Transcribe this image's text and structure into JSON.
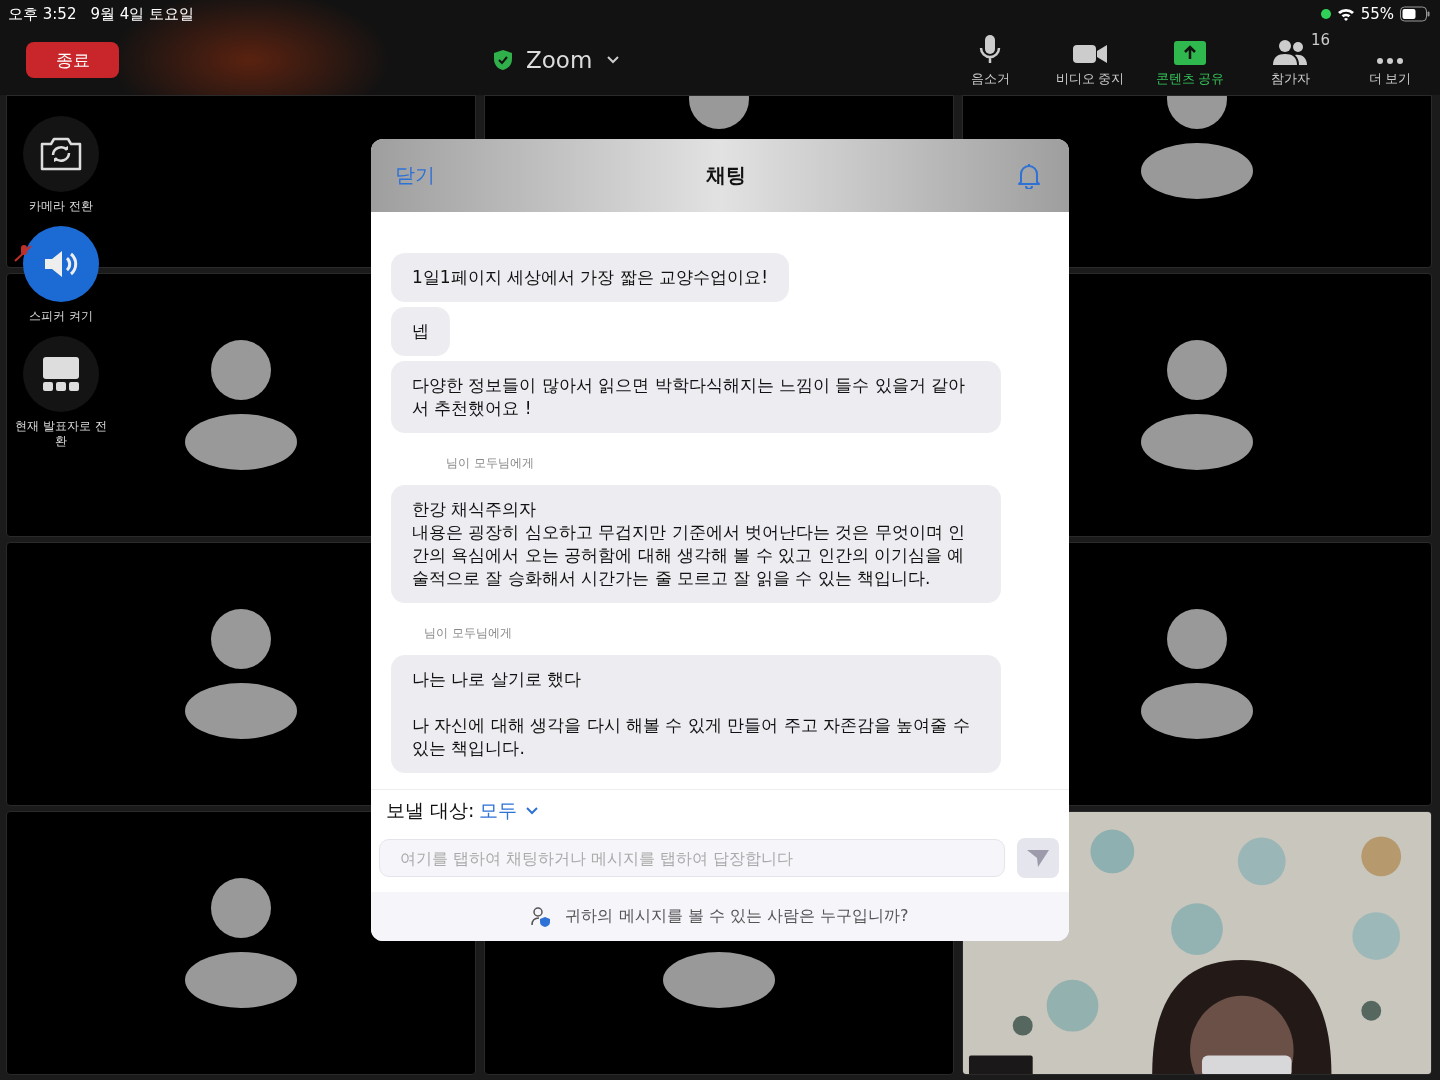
{
  "status_bar": {
    "time": "오후 3:52",
    "date": "9월 4일 토요일",
    "battery": "55%"
  },
  "toolbar": {
    "end_button": "종료",
    "title": "Zoom",
    "actions": [
      {
        "kind": "mic",
        "label": "음소거"
      },
      {
        "kind": "video",
        "label": "비디오 중지"
      },
      {
        "kind": "share",
        "label": "콘텐츠 공유"
      },
      {
        "kind": "participants",
        "label": "참가자",
        "count": "16"
      },
      {
        "kind": "more",
        "label": "더 보기"
      }
    ]
  },
  "side_controls": [
    {
      "kind": "camera",
      "label": "카메라 전환"
    },
    {
      "kind": "speaker",
      "label": "스피커 켜기"
    },
    {
      "kind": "layout",
      "label": "현재 발표자로 전환"
    }
  ],
  "tiles": [
    {
      "kind": "empty"
    },
    {
      "kind": "avatar_head"
    },
    {
      "kind": "avatar"
    },
    {
      "kind": "avatar"
    },
    {
      "kind": "avatar"
    },
    {
      "kind": "avatar"
    },
    {
      "kind": "avatar"
    },
    {
      "kind": "avatar"
    },
    {
      "kind": "avatar_body"
    },
    {
      "kind": "video"
    }
  ],
  "chat": {
    "close": "닫기",
    "title": "채팅",
    "messages": [
      {
        "kind": "bubble",
        "text": "1일1페이지 세상에서 가장 짧은 교양수업이요!"
      },
      {
        "kind": "bubble",
        "text": "넵"
      },
      {
        "kind": "bubble",
        "text": "다양한 정보들이 많아서 읽으면 박학다식해지는 느낌이 들수 있을거 같아서 추천했어요 !"
      },
      {
        "kind": "meta",
        "text": "님이 모두님에게"
      },
      {
        "kind": "bubble",
        "text": "한강 채식주의자\n내용은 굉장히 심오하고 무겁지만 기준에서 벗어난다는 것은 무엇이며 인간의 욕심에서 오는 공허함에 대해 생각해 볼 수 있고 인간의 이기심을 예술적으로 잘 승화해서 시간가는 줄 모르고 잘 읽을 수 있는 책입니다."
      },
      {
        "kind": "meta",
        "text": "님이 모두님에게"
      },
      {
        "kind": "bubble",
        "text": "나는 나로 살기로 했다\n\n나 자신에 대해 생각을 다시 해볼 수 있게 만들어 주고 자존감을 높여줄 수 있는 책입니다."
      }
    ],
    "send_to_label": "보낼 대상:",
    "send_to_value": "모두",
    "placeholder": "여기를 탭하여 채팅하거나 메시지를 탭하여 답장합니다",
    "privacy_notice": "귀하의 메시지를 볼 수 있는 사람은 누구입니까?"
  }
}
